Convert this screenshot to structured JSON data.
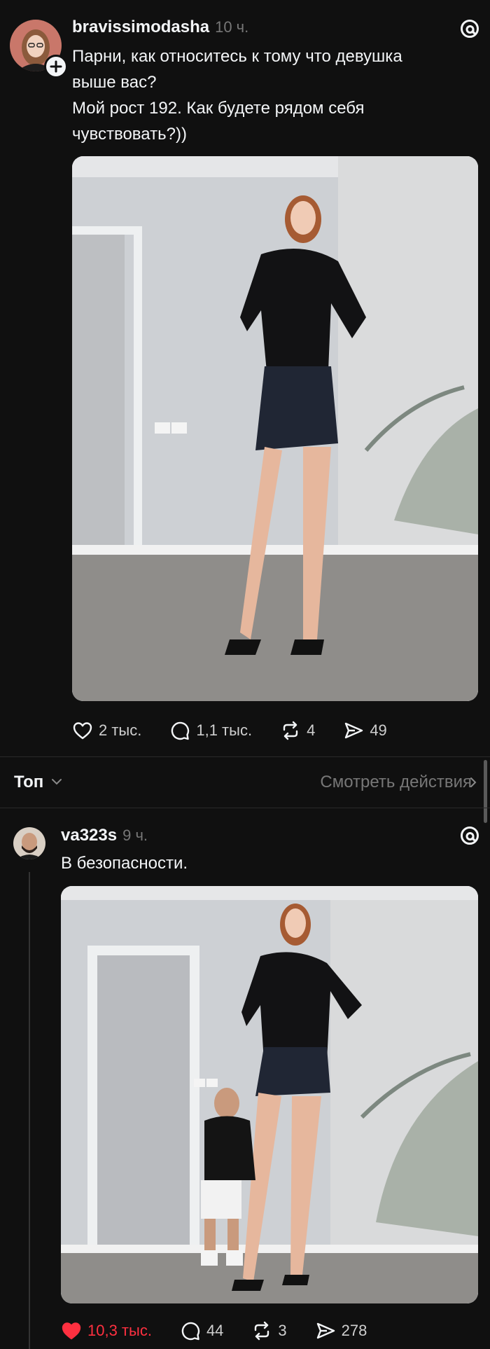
{
  "post1": {
    "username": "bravissimodasha",
    "time": "10 ч.",
    "text": "Парни, как относитесь к тому что девушка выше вас?\nМой рост 192. Как будете рядом себя чувствовать?))",
    "actions": {
      "likes": "2 тыс.",
      "comments": "1,1 тыс.",
      "reposts": "4",
      "shares": "49"
    }
  },
  "sortbar": {
    "label": "Топ",
    "view_activity": "Смотреть действия"
  },
  "post2": {
    "username": "va323s",
    "time": "9 ч.",
    "text": "В безопасности.",
    "actions": {
      "likes": "10,3 тыс.",
      "comments": "44",
      "reposts": "3",
      "shares": "278"
    }
  },
  "colors": {
    "background": "#101010",
    "text": "#f3f5f7",
    "muted": "#777777",
    "like_active": "#ff3040"
  }
}
